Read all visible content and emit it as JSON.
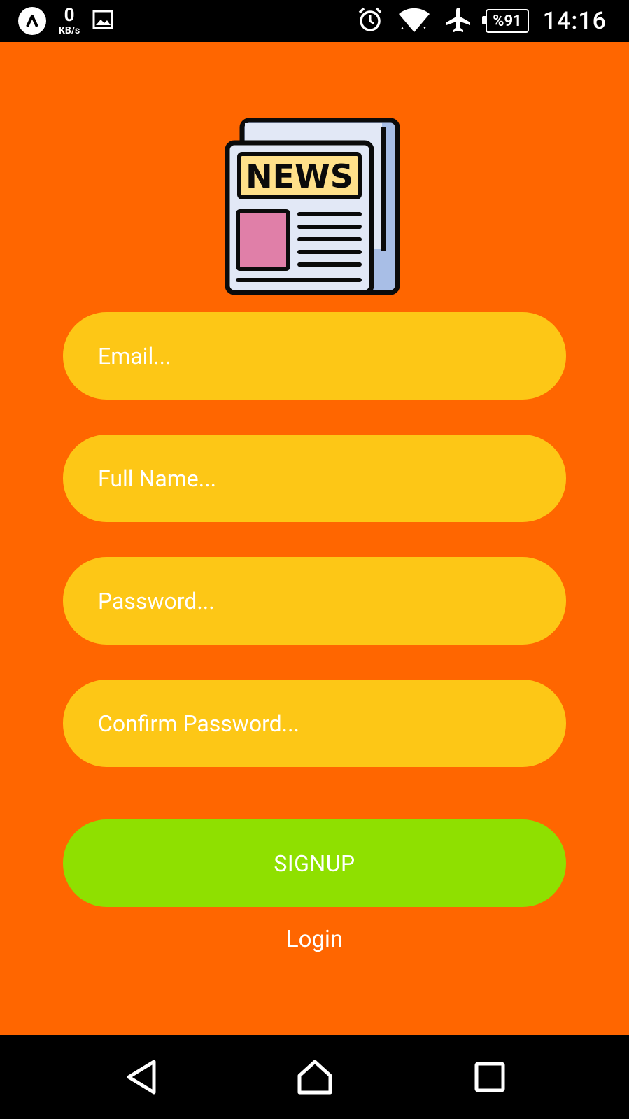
{
  "status_bar": {
    "net_speed_value": "0",
    "net_speed_unit": "KB/s",
    "battery": "%91",
    "time": "14:16",
    "icons": [
      "app-icon",
      "gallery-icon",
      "alarm-icon",
      "wifi-icon",
      "airplane-icon",
      "battery-icon"
    ]
  },
  "logo": {
    "text": "NEWS",
    "colors": {
      "frame": "#0B0B0B",
      "paper": "#E2E8F6",
      "back_page": "#A8BEE6",
      "banner": "#FFE08A",
      "photo": "#E07FA8"
    }
  },
  "form": {
    "email_placeholder": "Email...",
    "fullname_placeholder": "Full Name...",
    "password_placeholder": "Password...",
    "confirm_placeholder": "Confirm Password...",
    "signup_label": "SIGNUP",
    "login_label": "Login"
  },
  "colors": {
    "background": "#FF6600",
    "field": "#FDC716",
    "button": "#8FE000",
    "text": "#FFFFFF"
  },
  "nav_bar": {
    "icons": [
      "back-icon",
      "home-icon",
      "recent-apps-icon"
    ]
  }
}
